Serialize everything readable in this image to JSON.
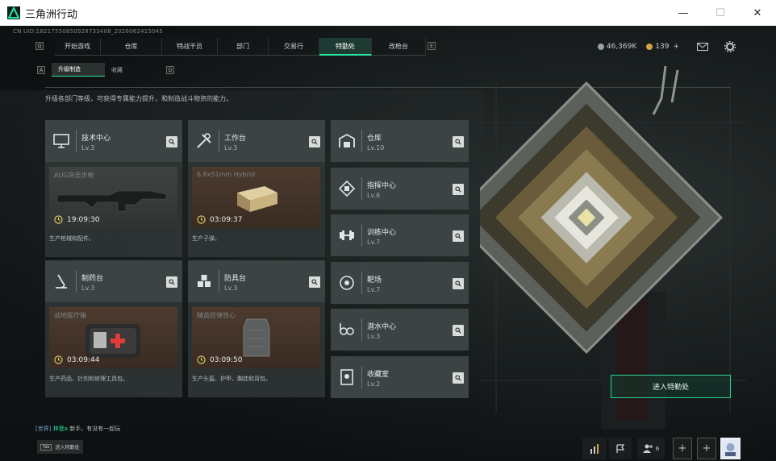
{
  "window": {
    "title": "三角洲行动",
    "minimize": "—",
    "maximize": "☐",
    "close": "✕"
  },
  "uid": "CN UID:18217550850928733408_2026062415045",
  "nav": {
    "left_key": "Q",
    "right_key": "E",
    "tabs": [
      {
        "label": "开始游戏",
        "active": false
      },
      {
        "label": "仓库",
        "active": false
      },
      {
        "label": "特战干员",
        "active": false
      },
      {
        "label": "部门",
        "active": false
      },
      {
        "label": "交易行",
        "active": false
      },
      {
        "label": "特勤处",
        "active": true
      },
      {
        "label": "改枪台",
        "active": false
      }
    ]
  },
  "currency": {
    "coins": "46,369K",
    "tickets": "139",
    "plus": "+",
    "colors": {
      "coins": "#9aa3a3",
      "tickets": "#d0a646"
    }
  },
  "subtabs": {
    "left_key": "A",
    "right_key": "D",
    "items": [
      {
        "label": "升级制造",
        "active": true
      },
      {
        "label": "收藏",
        "active": false
      }
    ]
  },
  "description": "升级各部门等级，可获得专属能力提升，和制造战斗物资的能力。",
  "big_cards": [
    {
      "name": "技术中心",
      "level": "Lv.3",
      "icon": "monitor-icon",
      "product": "AUG突击步枪",
      "timer": "19:09:30",
      "bg": "gray",
      "desc": "生产枪械和配件。"
    },
    {
      "name": "工作台",
      "level": "Lv.3",
      "icon": "tools-icon",
      "product": "6.8x51mm Hybrid",
      "timer": "03:09:37",
      "bg": "brown",
      "desc": "生产子弹。"
    },
    {
      "name": "制药台",
      "level": "Lv.3",
      "icon": "microscope-icon",
      "product": "战地医疗箱",
      "timer": "03:09:44",
      "bg": "brown",
      "desc": "生产药品、针剂和修理工具包。"
    },
    {
      "name": "防具台",
      "level": "Lv.3",
      "icon": "armor-parts-icon",
      "product": "精英防弹背心",
      "timer": "03:09:50",
      "bg": "brown",
      "desc": "生产头盔、护甲、胸挂和背包。"
    }
  ],
  "small_cards": [
    {
      "name": "仓库",
      "level": "Lv.10",
      "icon": "warehouse-icon"
    },
    {
      "name": "指挥中心",
      "level": "Lv.6",
      "icon": "command-icon"
    },
    {
      "name": "训练中心",
      "level": "Lv.7",
      "icon": "dumbbell-icon"
    },
    {
      "name": "靶场",
      "level": "Lv.7",
      "icon": "target-icon"
    },
    {
      "name": "潜水中心",
      "level": "Lv.3",
      "icon": "diving-icon"
    },
    {
      "name": "收藏室",
      "level": "Lv.2",
      "icon": "collection-icon"
    }
  ],
  "enter_button": "进入特勤处",
  "chat": {
    "channel": "[世界]",
    "user": "林登a",
    "message": "新手，有没有一起玩"
  },
  "tab_hint": {
    "key": "Tab",
    "label": "进入特勤处"
  },
  "bottom_bar": {
    "friends": "6"
  },
  "accent_color": "#27e6a0"
}
